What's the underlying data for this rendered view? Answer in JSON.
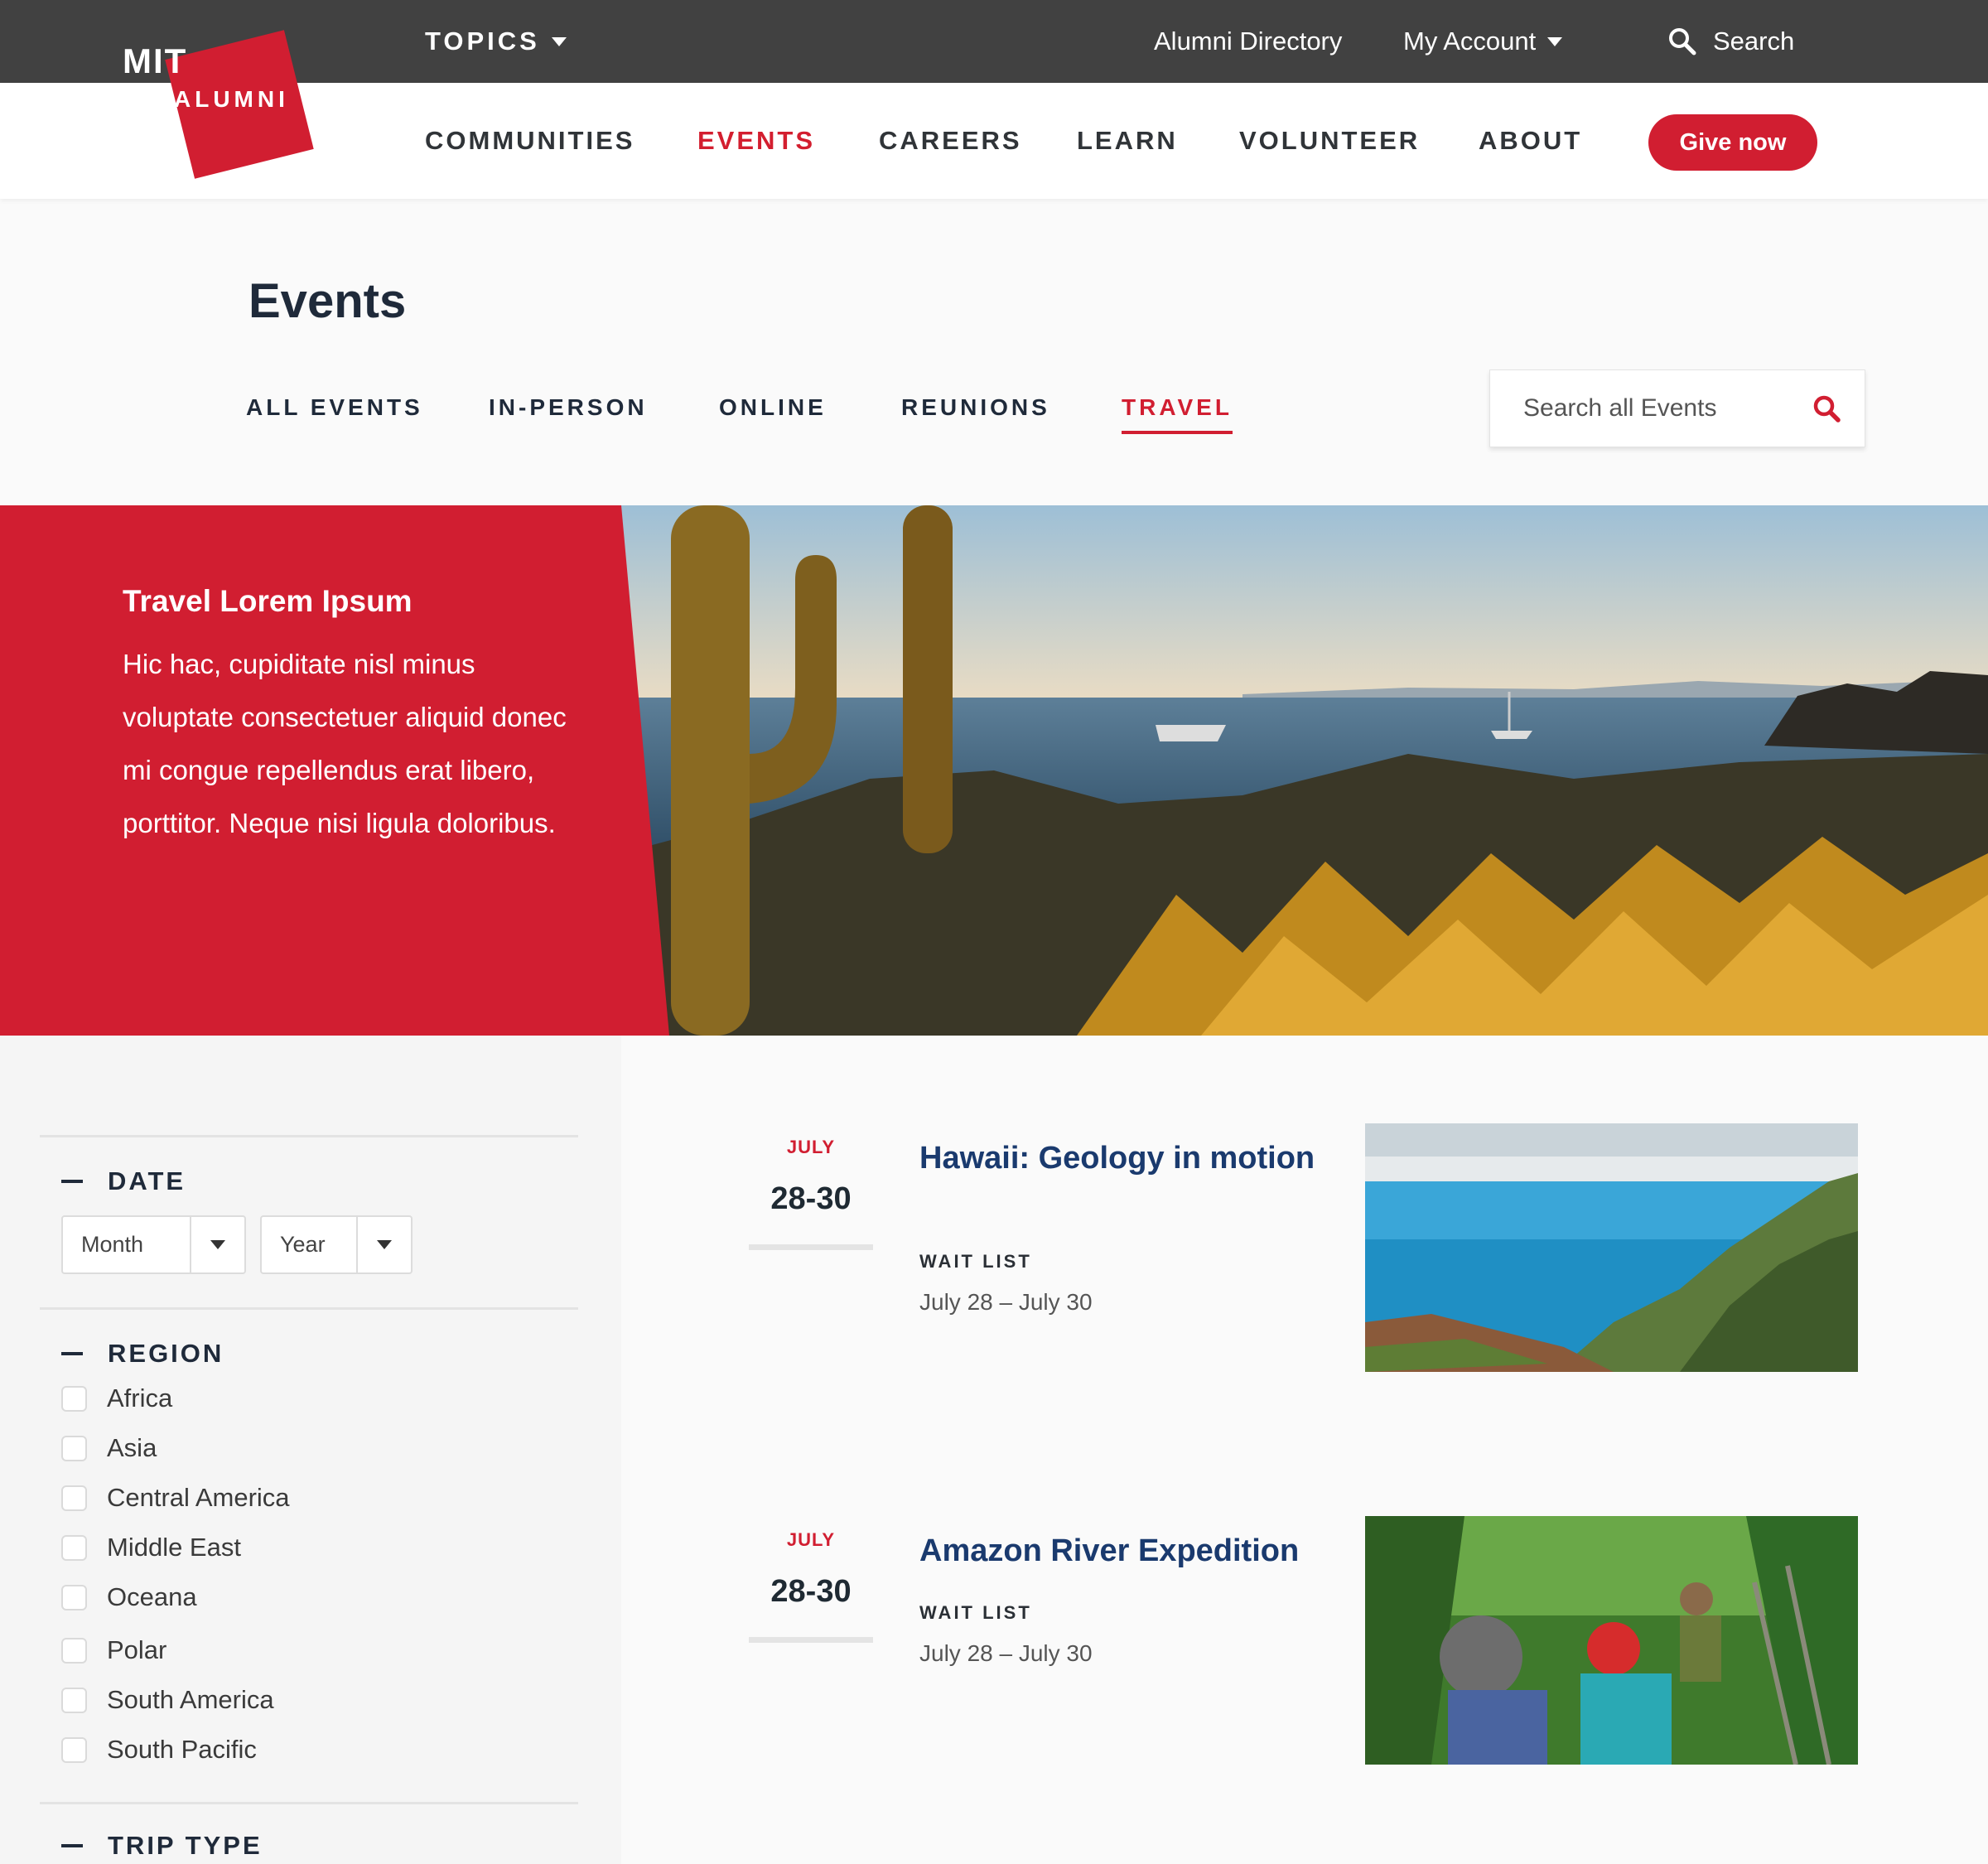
{
  "brand": {
    "logo_top": "MIT",
    "logo_bottom": "ALUMNI",
    "red": "#d11e31",
    "dark_bar": "#414141",
    "navy": "#1a3a6e"
  },
  "topbar": {
    "topics_label": "TOPICS",
    "alumni_directory": "Alumni Directory",
    "my_account": "My Account",
    "search_label": "Search"
  },
  "nav": {
    "items": [
      "COMMUNITIES",
      "EVENTS",
      "CAREERS",
      "LEARN",
      "VOLUNTEER",
      "ABOUT"
    ],
    "active": "EVENTS",
    "give_now": "Give now"
  },
  "page": {
    "title": "Events",
    "tabs": [
      "ALL EVENTS",
      "IN-PERSON",
      "ONLINE",
      "REUNIONS",
      "TRAVEL"
    ],
    "active_tab": "TRAVEL",
    "search_placeholder": "Search all Events"
  },
  "hero": {
    "title": "Travel Lorem Ipsum",
    "body": "Hic hac, cupiditate nisl minus voluptate consectetuer aliquid donec mi congue repellendus erat libero, porttitor. Neque nisi ligula doloribus."
  },
  "filters": {
    "date": {
      "heading": "DATE",
      "month_label": "Month",
      "year_label": "Year"
    },
    "region": {
      "heading": "REGION",
      "options": [
        "Africa",
        "Asia",
        "Central America",
        "Middle East",
        "Oceana",
        "Polar",
        "South America",
        "South Pacific"
      ]
    },
    "trip_type": {
      "heading": "TRIP TYPE"
    }
  },
  "events": [
    {
      "month": "JULY",
      "days": "28-30",
      "title": "Hawaii: Geology in motion",
      "status": "WAIT LIST",
      "dates": "July 28 – July 30",
      "image": "coastal-cliffs-photo"
    },
    {
      "month": "JULY",
      "days": "28-30",
      "title": "Amazon River Expedition",
      "status": "WAIT LIST",
      "dates": "July 28 – July 30",
      "image": "rainforest-bridge-photo"
    }
  ]
}
